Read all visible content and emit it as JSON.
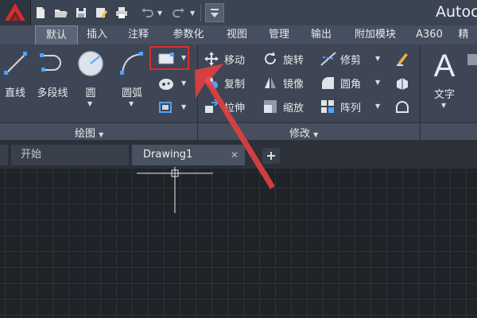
{
  "app": {
    "title": "Autoc"
  },
  "ribbon_tabs": [
    "默认",
    "插入",
    "注释",
    "参数化",
    "视图",
    "管理",
    "输出",
    "附加模块",
    "A360",
    "精"
  ],
  "draw_panel": {
    "tools": {
      "line": "直线",
      "polyline": "多段线",
      "circle": "圆",
      "arc": "圆弧"
    },
    "footer": "绘图"
  },
  "modify_panel": {
    "tools": {
      "move": "移动",
      "rotate": "旋转",
      "trim": "修剪",
      "copy": "复制",
      "mirror": "镜像",
      "fillet": "圆角",
      "stretch": "拉伸",
      "scale": "缩放",
      "array": "阵列"
    },
    "footer": "修改"
  },
  "annotation_panel": {
    "text": "文字"
  },
  "doc_tabs": {
    "start": "开始",
    "drawing": "Drawing1"
  },
  "colors": {
    "highlight": "#e12b2b",
    "arrow": "#e04040"
  }
}
